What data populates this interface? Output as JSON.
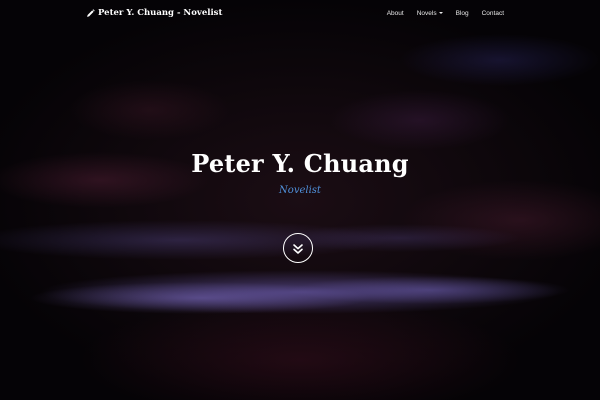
{
  "nav": {
    "brand": {
      "icon": "pencil-icon",
      "label": "Peter Y. Chuang - Novelist"
    },
    "links": [
      {
        "label": "About"
      },
      {
        "label": "Novels",
        "icon": "caret-down-icon"
      },
      {
        "label": "Blog"
      },
      {
        "label": "Contact"
      }
    ]
  },
  "hero": {
    "title": "Peter Y. Chuang",
    "subtitle": "Novelist",
    "scroll_button": {
      "icon": "chevron-double-down-icon"
    }
  },
  "colors": {
    "accent": "#4f8fd9",
    "text": "#ffffff",
    "background": "#050306"
  }
}
